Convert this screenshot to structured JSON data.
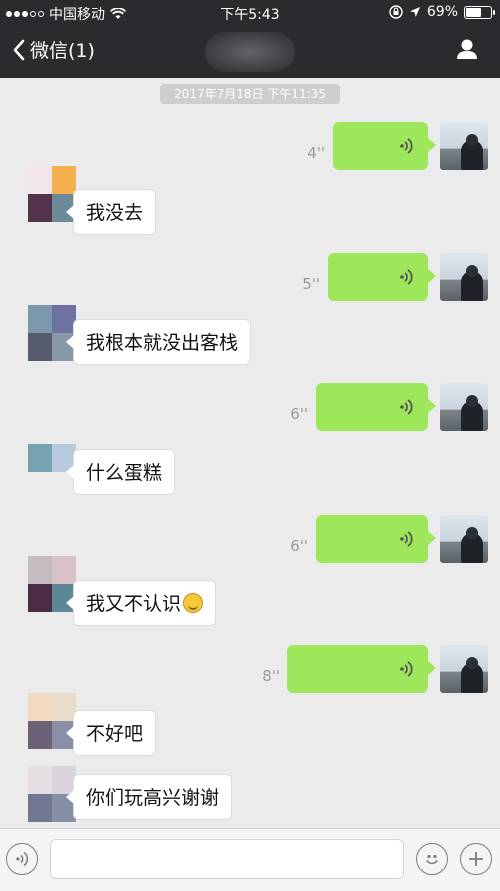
{
  "status_bar": {
    "carrier": "中国移动",
    "time": "下午5:43",
    "battery_percent": "69%",
    "battery_level": 0.69
  },
  "nav": {
    "back_label": "微信(1)"
  },
  "timestamp": "2017年7月18日 下午11:35",
  "messages": [
    {
      "side": "right",
      "type": "voice",
      "duration": "4''"
    },
    {
      "side": "left",
      "type": "text",
      "text": "我没去"
    },
    {
      "side": "right",
      "type": "voice",
      "duration": "5''"
    },
    {
      "side": "left",
      "type": "text",
      "text": "我根本就没出客栈"
    },
    {
      "side": "right",
      "type": "voice",
      "duration": "6''"
    },
    {
      "side": "left",
      "type": "text",
      "text": "什么蛋糕"
    },
    {
      "side": "right",
      "type": "voice",
      "duration": "6''"
    },
    {
      "side": "left",
      "type": "text",
      "text": "我又不认识",
      "emoji": "smile-emoji"
    },
    {
      "side": "right",
      "type": "voice",
      "duration": "8''"
    },
    {
      "side": "left",
      "type": "text",
      "text": "不好吧"
    },
    {
      "side": "left",
      "type": "text",
      "text": "你们玩高兴谢谢"
    }
  ],
  "colors": {
    "bar_dark": "#2b2b2f",
    "chat_bg": "#ebebeb",
    "voice_green": "#9ee75b"
  }
}
